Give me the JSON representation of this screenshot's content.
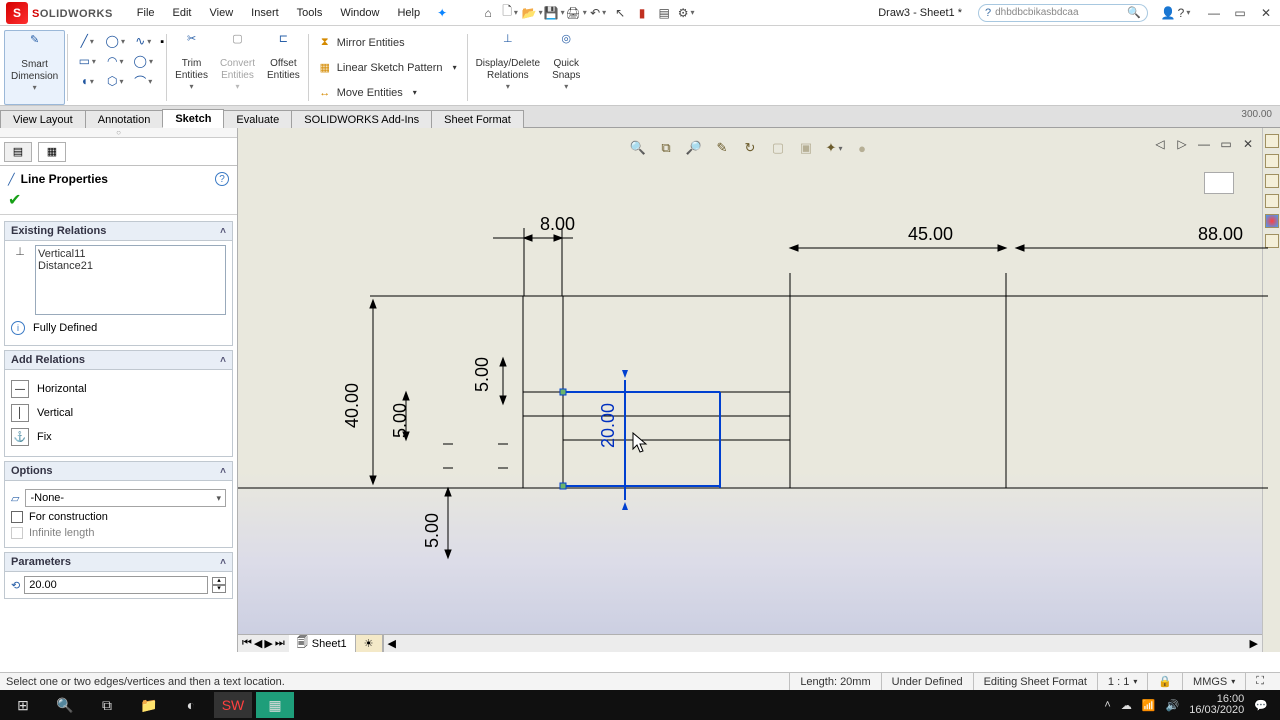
{
  "app": {
    "brand_red": "S",
    "brand_dark": "OLIDWORKS",
    "doc": "Draw3 - Sheet1 *"
  },
  "menu": {
    "file": "File",
    "edit": "Edit",
    "view": "View",
    "insert": "Insert",
    "tools": "Tools",
    "window": "Window",
    "help": "Help"
  },
  "search": {
    "value": "dhbdbcbikasbdcaa"
  },
  "ribbon": {
    "smartdim": "Smart\nDimension",
    "trim": "Trim\nEntities",
    "convert": "Convert\nEntities",
    "offset": "Offset\nEntities",
    "mirror": "Mirror Entities",
    "linear": "Linear Sketch Pattern",
    "move": "Move Entities",
    "disprel": "Display/Delete\nRelations",
    "quicksnap": "Quick\nSnaps"
  },
  "tabs": {
    "viewlayout": "View Layout",
    "annotation": "Annotation",
    "sketch": "Sketch",
    "evaluate": "Evaluate",
    "addins": "SOLIDWORKS Add-Ins",
    "sheetformat": "Sheet Format"
  },
  "ruler_top": "300.00",
  "pm": {
    "title": "Line Properties",
    "sec_existing": "Existing Relations",
    "rel1": "Vertical11",
    "rel2": "Distance21",
    "fully": "Fully Defined",
    "sec_add": "Add Relations",
    "horiz": "Horizontal",
    "vert": "Vertical",
    "fix": "Fix",
    "sec_options": "Options",
    "none": "-None-",
    "construction": "For construction",
    "infinite": "Infinite length",
    "sec_param": "Parameters",
    "param_val": "20.00"
  },
  "dims": {
    "d8": "8.00",
    "d45": "45.00",
    "d88": "88.00",
    "d40": "40.00",
    "d5a": "5.00",
    "d5b": "5.00",
    "d5c": "5.00",
    "d20": "20.00"
  },
  "sheet": "Sheet1",
  "status": {
    "hint": "Select one or two edges/vertices and then a text location.",
    "len": "Length: 20mm",
    "def": "Under Defined",
    "mode": "Editing Sheet Format",
    "scale": "1 : 1",
    "units": "MMGS"
  },
  "tray": {
    "time": "16:00",
    "date": "16/03/2020"
  }
}
